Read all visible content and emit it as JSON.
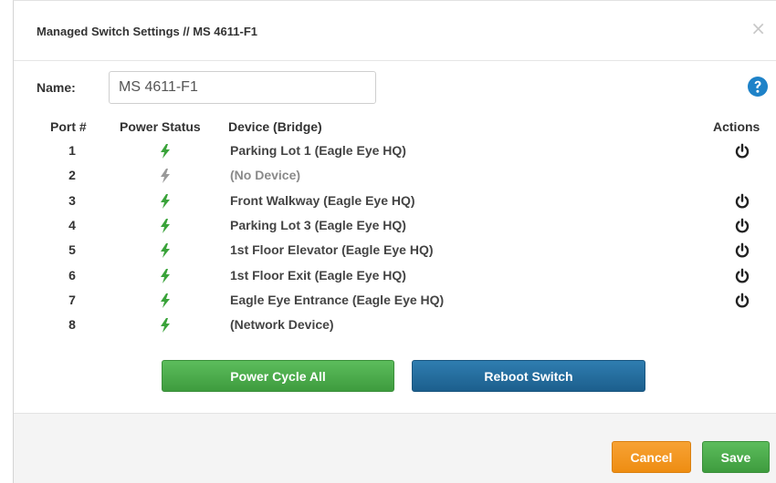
{
  "dialog": {
    "title": "Managed Switch Settings // MS 4611-F1",
    "close_glyph": "×"
  },
  "name_field": {
    "label": "Name:",
    "value": "MS 4611-F1"
  },
  "table": {
    "headers": {
      "port": "Port #",
      "power": "Power Status",
      "device": "Device (Bridge)",
      "actions": "Actions"
    },
    "rows": [
      {
        "port": "1",
        "device": "Parking Lot 1 (Eagle Eye HQ)",
        "power_on": true,
        "has_action": true
      },
      {
        "port": "2",
        "device": "(No Device)",
        "power_on": false,
        "has_action": false
      },
      {
        "port": "3",
        "device": "Front Walkway (Eagle Eye HQ)",
        "power_on": true,
        "has_action": true
      },
      {
        "port": "4",
        "device": "Parking Lot 3 (Eagle Eye HQ)",
        "power_on": true,
        "has_action": true
      },
      {
        "port": "5",
        "device": "1st Floor Elevator (Eagle Eye HQ)",
        "power_on": true,
        "has_action": true
      },
      {
        "port": "6",
        "device": "1st Floor Exit (Eagle Eye HQ)",
        "power_on": true,
        "has_action": true
      },
      {
        "port": "7",
        "device": "Eagle Eye Entrance (Eagle Eye HQ)",
        "power_on": true,
        "has_action": true
      },
      {
        "port": "8",
        "device": "(Network Device)",
        "power_on": true,
        "has_action": false
      }
    ]
  },
  "buttons": {
    "power_cycle_all": "Power Cycle All",
    "reboot_switch": "Reboot Switch",
    "cancel": "Cancel",
    "save": "Save"
  },
  "icons": {
    "help": "help-icon",
    "power_status": "lightning-bolt-icon",
    "action": "power-icon",
    "close": "close-icon"
  },
  "colors": {
    "power_on": "#3aa33a",
    "power_off": "#999999",
    "help": "#1e82c8",
    "green_button": "#4caf50",
    "blue_button": "#236b9b",
    "orange_button": "#f0951d"
  }
}
